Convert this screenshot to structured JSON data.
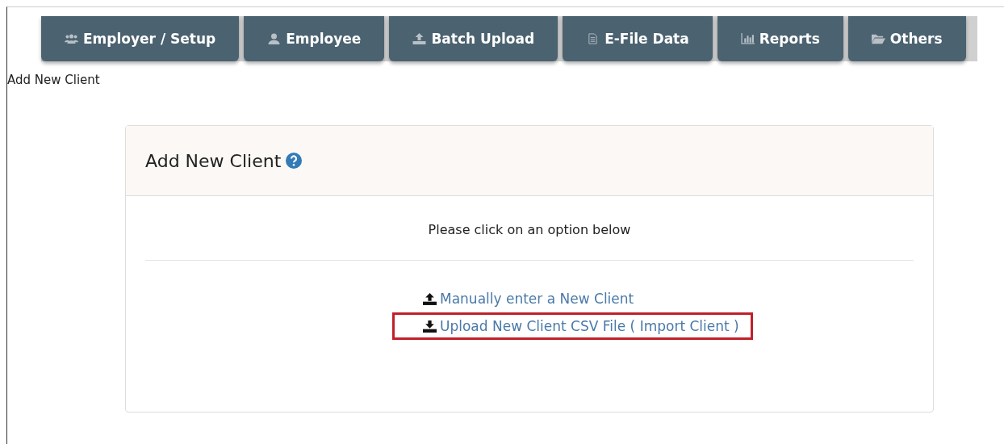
{
  "nav_tabs": [
    {
      "label": "Employer / Setup",
      "kind": "users"
    },
    {
      "label": "Employee",
      "kind": "user"
    },
    {
      "label": "Batch Upload",
      "kind": "upload"
    },
    {
      "label": "E-File Data",
      "kind": "file"
    },
    {
      "label": "Reports",
      "kind": "chart"
    },
    {
      "label": "Others",
      "kind": "folder"
    }
  ],
  "breadcrumb": "Add New Client",
  "panel": {
    "title": "Add New Client",
    "instruction": "Please click on an option below",
    "options": [
      {
        "label": "Manually enter a New Client",
        "kind": "upload",
        "highlighted": false
      },
      {
        "label": "Upload New Client CSV File ( Import Client )",
        "kind": "download",
        "highlighted": true
      }
    ]
  }
}
